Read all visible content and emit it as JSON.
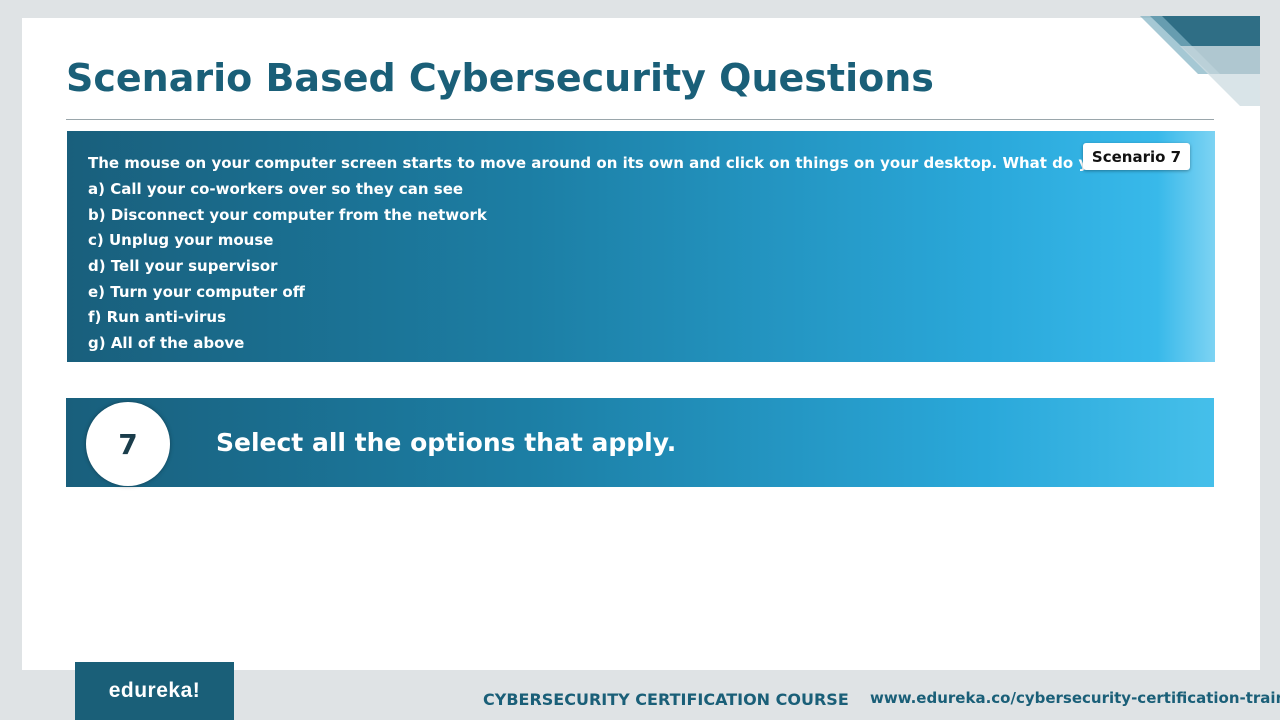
{
  "slide": {
    "title": "Scenario Based Cybersecurity Questions"
  },
  "scenario": {
    "tag": "Scenario 7",
    "question": "The mouse on your computer screen starts to move around on its own and click on things on your desktop. What do you do",
    "options": [
      "a) Call your co-workers over so they can see",
      "b) Disconnect your computer from the network",
      "c) Unplug your mouse",
      "d) Tell your supervisor",
      "e) Turn your computer off",
      "f) Run anti-virus",
      "g) All of the above"
    ]
  },
  "instruction": {
    "number": "7",
    "text": "Select all the options that apply."
  },
  "footer": {
    "logo": "edureka!",
    "course": "CYBERSECURITY CERTIFICATION COURSE",
    "url": "www.edureka.co/cybersecurity-certification-training"
  },
  "colors": {
    "title": "#1a5f78",
    "gradient_start": "#195f7c",
    "gradient_end": "#38b9ea"
  }
}
